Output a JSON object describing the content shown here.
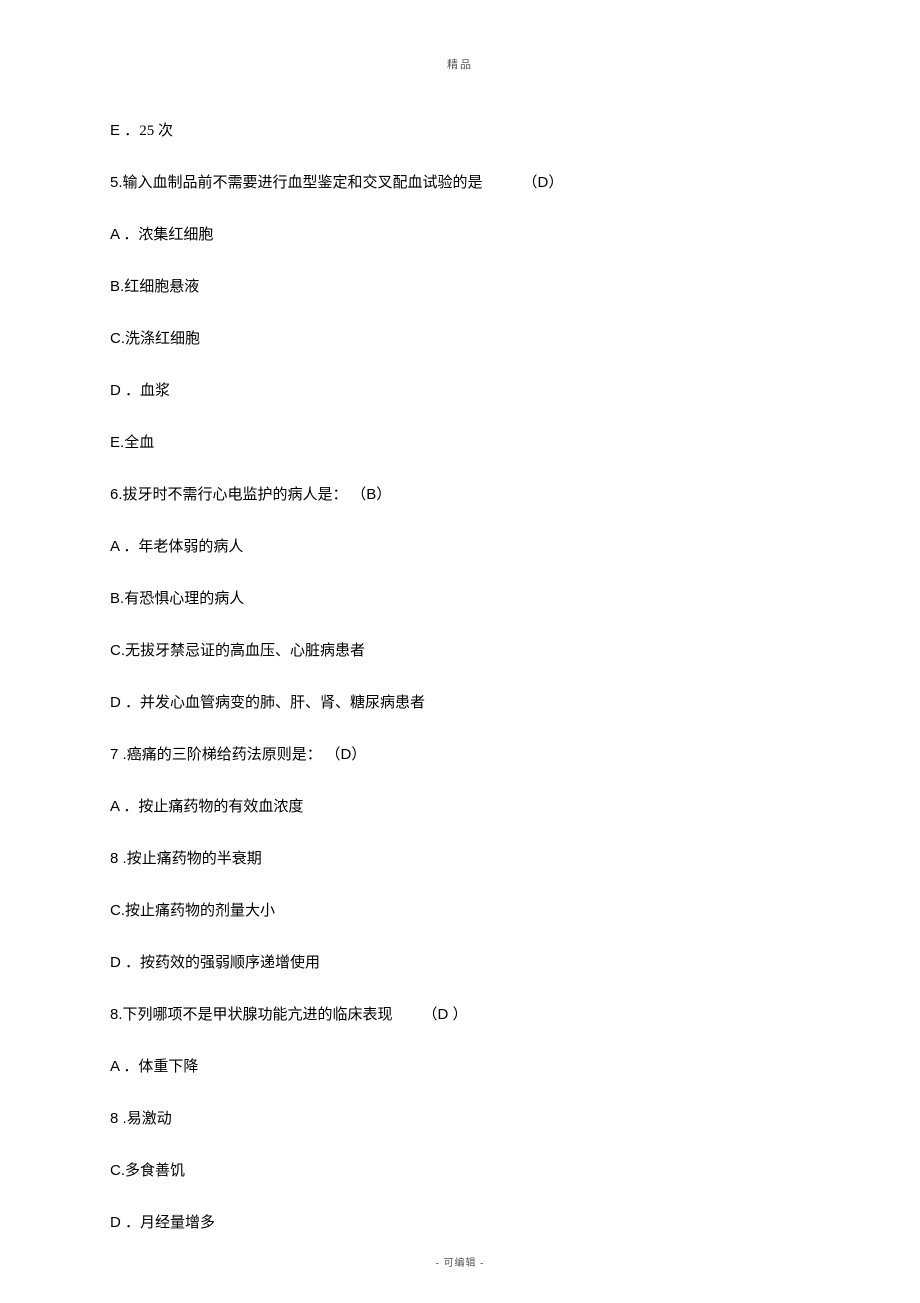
{
  "header": "精品",
  "footer": "- 可编辑 -",
  "lines": [
    {
      "prefix": "E ．",
      "text": "25 次",
      "answer": ""
    },
    {
      "prefix": "5.",
      "text": "输入血制品前不需要进行血型鉴定和交叉配血试验的是",
      "answer": "（D）",
      "gap": "small"
    },
    {
      "prefix": "A ．",
      "text": "浓集红细胞",
      "answer": ""
    },
    {
      "prefix": "B.",
      "text": "红细胞悬液",
      "answer": ""
    },
    {
      "prefix": "C.",
      "text": "洗涤红细胞",
      "answer": ""
    },
    {
      "prefix": "D ．",
      "text": "血浆",
      "answer": ""
    },
    {
      "prefix": "E.",
      "text": "全血",
      "answer": ""
    },
    {
      "prefix": "6.",
      "text": "拔牙时不需行心电监护的病人是：",
      "answer": "（B）",
      "gap": "none"
    },
    {
      "prefix": "A ．",
      "text": "年老体弱的病人",
      "answer": ""
    },
    {
      "prefix": "B.",
      "text": "有恐惧心理的病人",
      "answer": ""
    },
    {
      "prefix": "C.",
      "text": "无拔牙禁忌证的高血压、心脏病患者",
      "answer": ""
    },
    {
      "prefix": "D ．",
      "text": "并发心血管病变的肺、肝、肾、糖尿病患者",
      "answer": ""
    },
    {
      "prefix": "7 .",
      "text": "癌痛的三阶梯给药法原则是：",
      "answer": "（D）",
      "gap": "none"
    },
    {
      "prefix": "A ．",
      "text": "按止痛药物的有效血浓度",
      "answer": ""
    },
    {
      "prefix": "8 .",
      "text": "按止痛药物的半衰期",
      "answer": ""
    },
    {
      "prefix": "C.",
      "text": "按止痛药物的剂量大小",
      "answer": ""
    },
    {
      "prefix": "D ．",
      "text": "按药效的强弱顺序递增使用",
      "answer": ""
    },
    {
      "prefix": "8.",
      "text": "下列哪项不是甲状腺功能亢进的临床表现",
      "answer": "（D ）",
      "gap": "med"
    },
    {
      "prefix": "A ．",
      "text": "体重下降",
      "answer": ""
    },
    {
      "prefix": "8 .",
      "text": "易激动",
      "answer": ""
    },
    {
      "prefix": "C.",
      "text": "多食善饥",
      "answer": ""
    },
    {
      "prefix": "D ．",
      "text": "月经量增多",
      "answer": ""
    }
  ]
}
